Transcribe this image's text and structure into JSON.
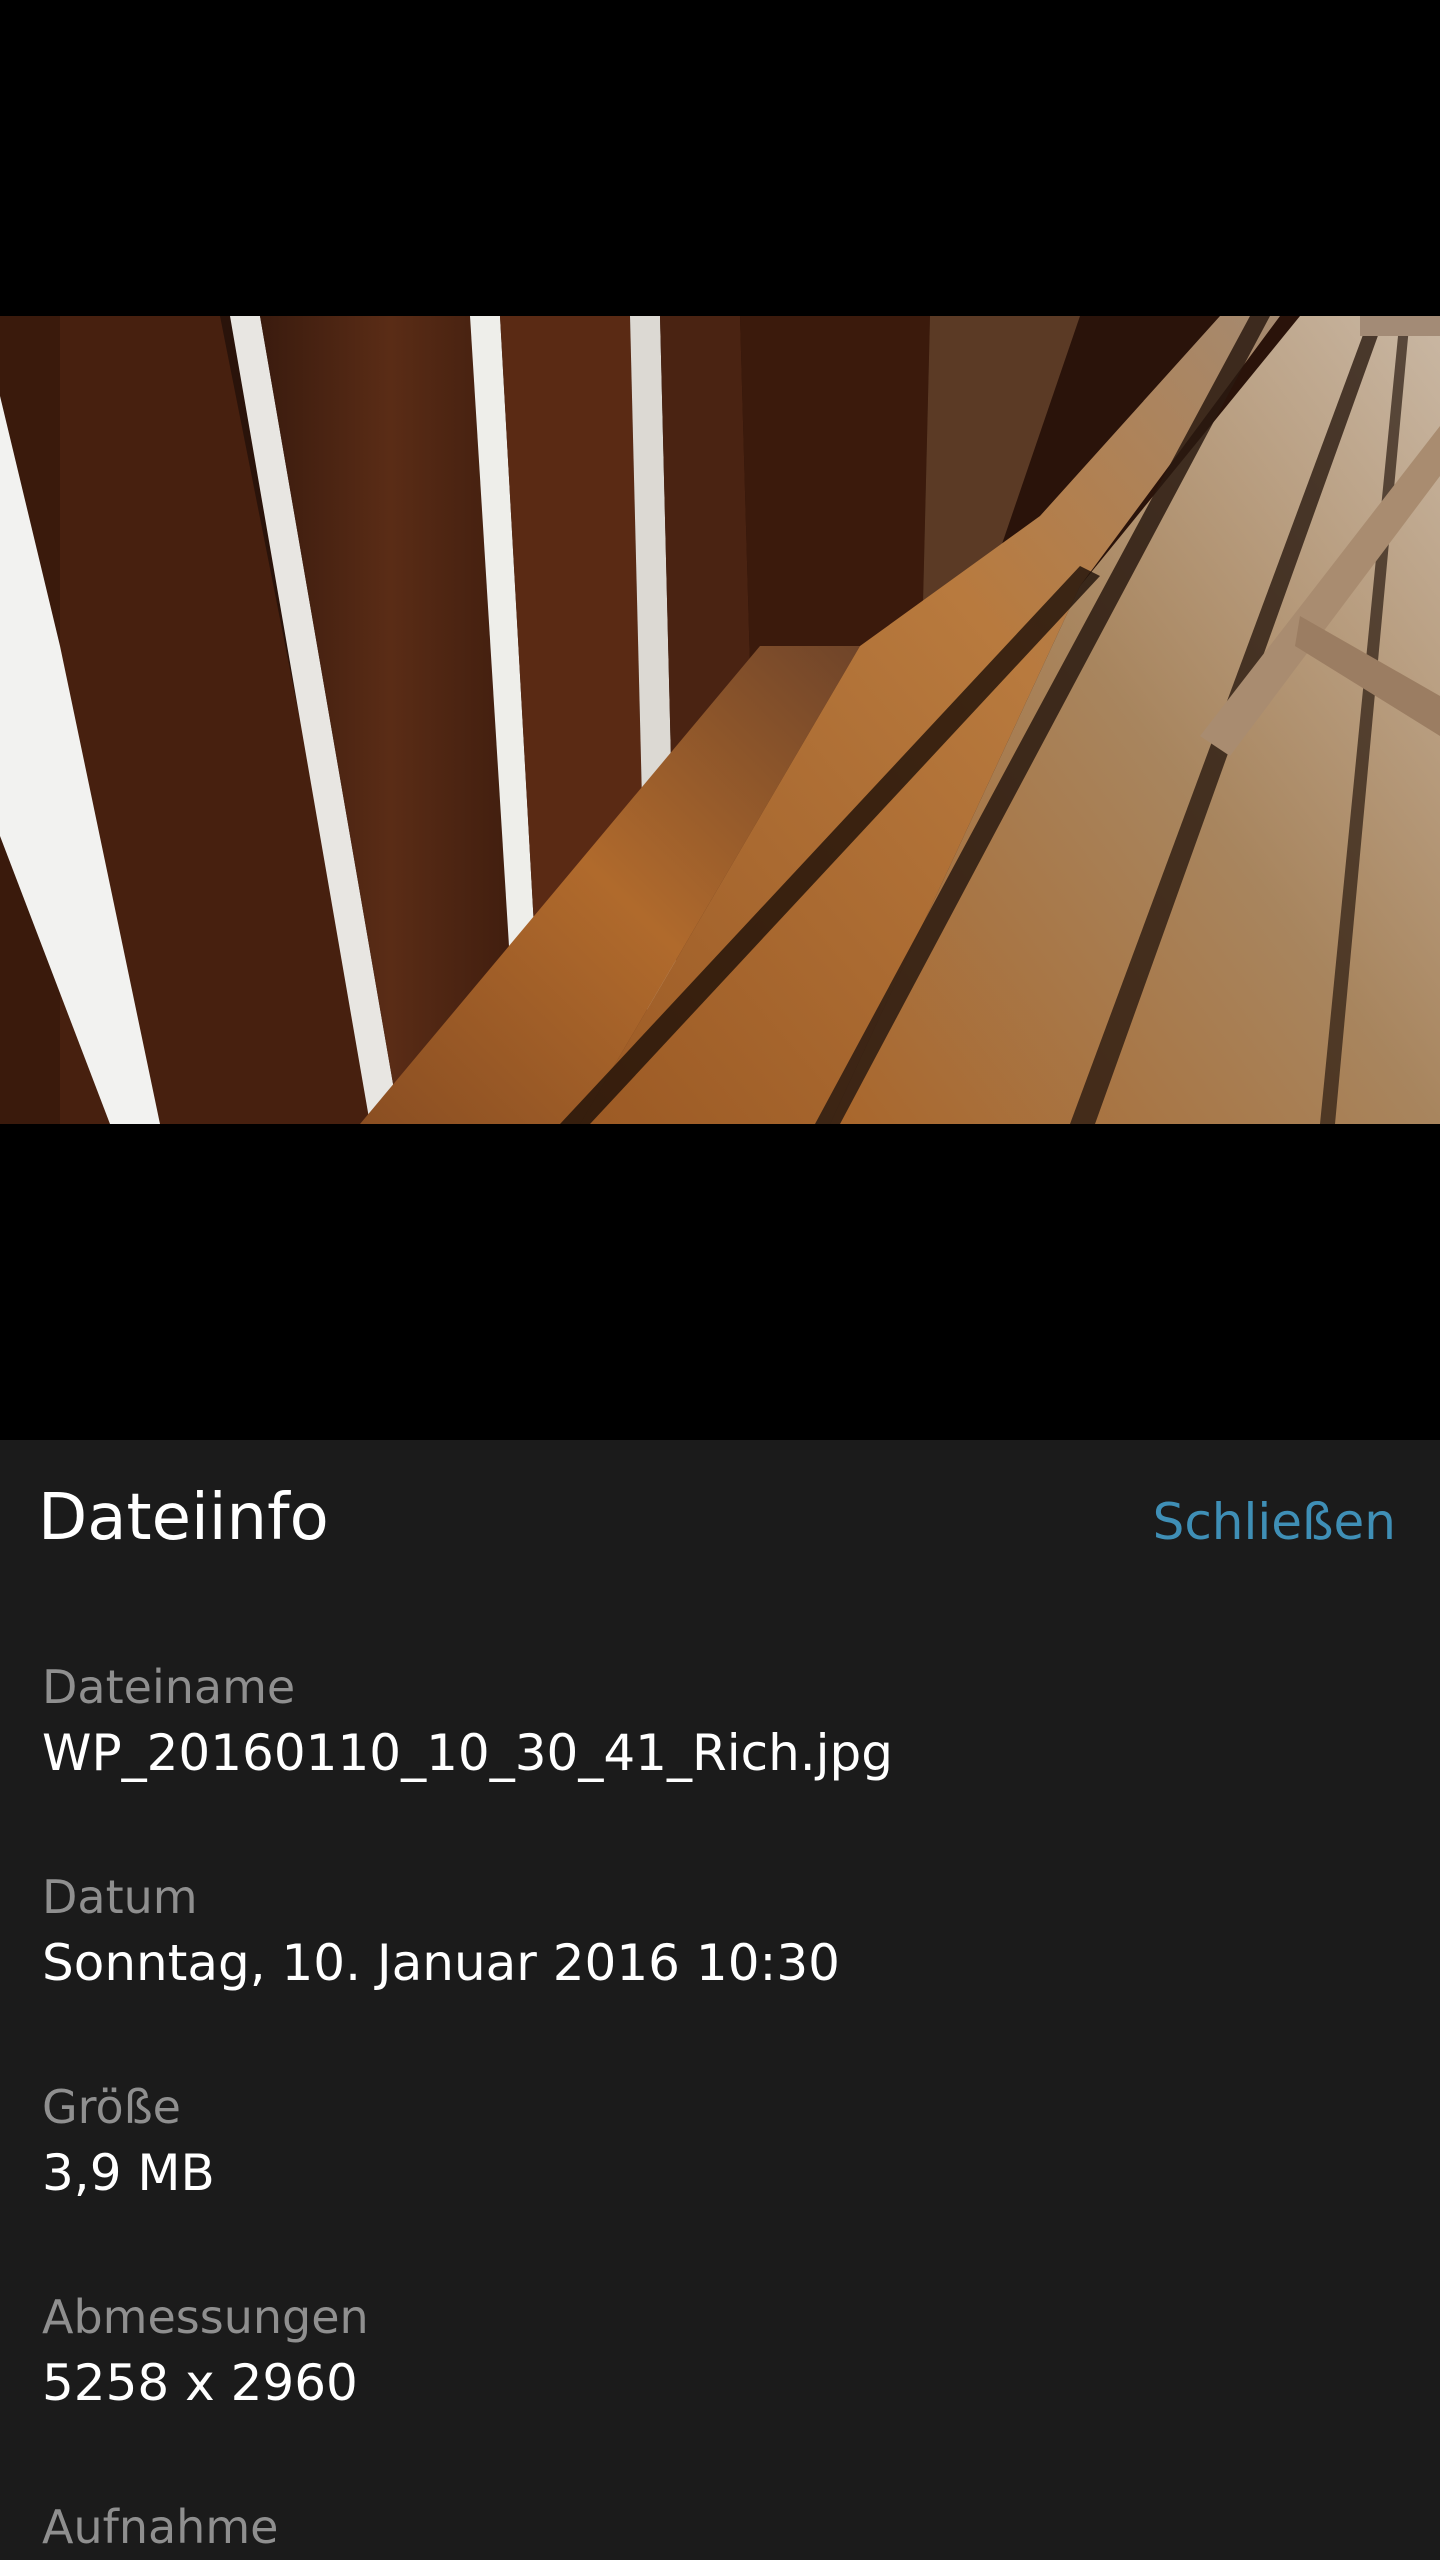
{
  "panel": {
    "title": "Dateiinfo",
    "close_label": "Schließen"
  },
  "fields": [
    {
      "label": "Dateiname",
      "value": "WP_20160110_10_30_41_Rich.jpg"
    },
    {
      "label": "Datum",
      "value": "Sonntag, 10. Januar 2016 10:30"
    },
    {
      "label": "Größe",
      "value": "3,9 MB"
    },
    {
      "label": "Abmessungen",
      "value": "5258 x 2960"
    },
    {
      "label": "Aufnahme",
      "value": ""
    }
  ],
  "colors": {
    "panel_background": "#1b1b1b",
    "accent": "#3f8fb6",
    "label": "#8f8f8f",
    "value": "#ffffff"
  }
}
